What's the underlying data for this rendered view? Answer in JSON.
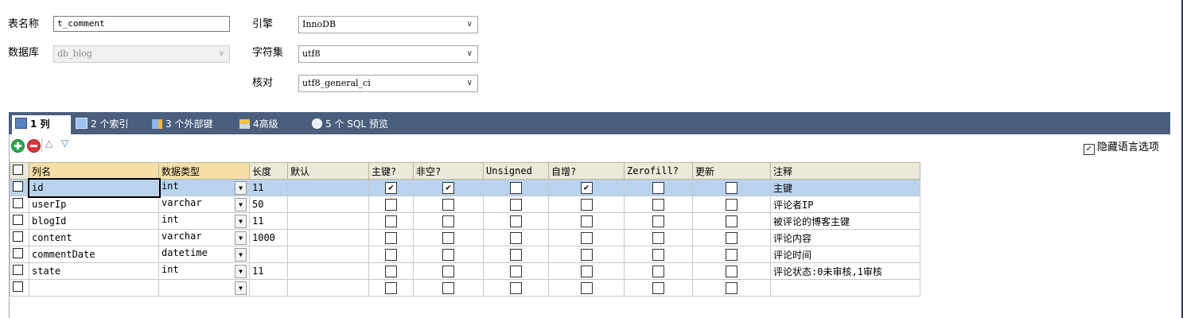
{
  "form": {
    "table_name_label": "表名称",
    "table_name_value": "t_comment",
    "database_label": "数据库",
    "database_value": "db_blog",
    "engine_label": "引擎",
    "engine_value": "InnoDB",
    "charset_label": "字符集",
    "charset_value": "utf8",
    "collation_label": "核对",
    "collation_value": "utf8_general_ci"
  },
  "tabs": [
    {
      "label": "1 列",
      "icon": "columns-icon",
      "active": true
    },
    {
      "label": "2 个索引",
      "icon": "index-icon"
    },
    {
      "label": "3 个外部键",
      "icon": "foreign-key-icon"
    },
    {
      "label": "4高级",
      "icon": "advanced-icon"
    },
    {
      "label": "5 个 SQL 预览",
      "icon": "sql-preview-icon"
    }
  ],
  "toolbar": {
    "hide_lang_label": "隐藏语言选项",
    "hide_lang_checked": true
  },
  "grid": {
    "headers": [
      "列名",
      "数据类型",
      "长度",
      "默认",
      "主键?",
      "非空?",
      "Unsigned",
      "自增?",
      "Zerofill?",
      "更新",
      "注释"
    ],
    "rows": [
      {
        "name": "id",
        "type": "int",
        "length": "11",
        "default": "",
        "pk": true,
        "notnull": true,
        "unsigned": false,
        "autoinc": true,
        "zerofill": false,
        "update": false,
        "comment": "主键"
      },
      {
        "name": "userIp",
        "type": "varchar",
        "length": "50",
        "default": "",
        "pk": false,
        "notnull": false,
        "unsigned": false,
        "autoinc": false,
        "zerofill": false,
        "update": false,
        "comment": "评论者IP"
      },
      {
        "name": "blogId",
        "type": "int",
        "length": "11",
        "default": "",
        "pk": false,
        "notnull": false,
        "unsigned": false,
        "autoinc": false,
        "zerofill": false,
        "update": false,
        "comment": "被评论的博客主键"
      },
      {
        "name": "content",
        "type": "varchar",
        "length": "1000",
        "default": "",
        "pk": false,
        "notnull": false,
        "unsigned": false,
        "autoinc": false,
        "zerofill": false,
        "update": false,
        "comment": "评论内容"
      },
      {
        "name": "commentDate",
        "type": "datetime",
        "length": "",
        "default": "",
        "pk": false,
        "notnull": false,
        "unsigned": false,
        "autoinc": false,
        "zerofill": false,
        "update": false,
        "comment": "评论时间"
      },
      {
        "name": "state",
        "type": "int",
        "length": "11",
        "default": "",
        "pk": false,
        "notnull": false,
        "unsigned": false,
        "autoinc": false,
        "zerofill": false,
        "update": false,
        "comment": "评论状态:0未审核,1审核"
      },
      {
        "name": "",
        "type": "",
        "length": "",
        "default": "",
        "pk": false,
        "notnull": false,
        "unsigned": false,
        "autoinc": false,
        "zerofill": false,
        "update": false,
        "comment": ""
      }
    ]
  },
  "colors": {
    "tab_bar": "#4a5f7e",
    "selected_row": "#b9d3ee",
    "header_bg": "#ece9d8",
    "add_button": "#2fa84f",
    "remove_button": "#d9363e"
  }
}
